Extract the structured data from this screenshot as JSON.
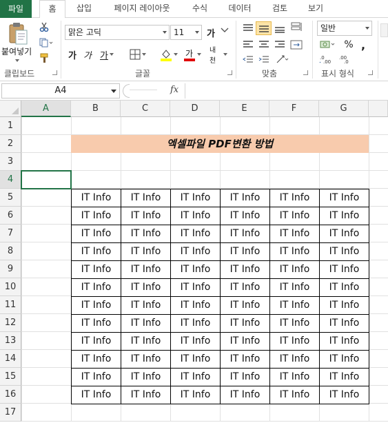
{
  "tabs": [
    "파일",
    "홈",
    "삽입",
    "페이지 레이아웃",
    "수식",
    "데이터",
    "검토",
    "보기"
  ],
  "active_tab": "홈",
  "clipboard": {
    "paste_label": "붙여넣기",
    "group_label": "클립보드"
  },
  "font": {
    "name": "맑은 고딕",
    "size": "11",
    "group_label": "글꼴",
    "grow_glyph": "가",
    "bold_glyph": "가",
    "italic_glyph": "가",
    "underline_glyph": "가",
    "phonetic_glyph": "내천"
  },
  "alignment": {
    "group_label": "맞춤"
  },
  "number": {
    "format": "일반",
    "percent": "%",
    "comma": ",",
    "group_label": "표시 형식"
  },
  "formula_bar": {
    "name_box": "A4",
    "fx_label": "fx",
    "formula": ""
  },
  "sheet": {
    "columns": [
      "A",
      "B",
      "C",
      "D",
      "E",
      "F",
      "G"
    ],
    "rows": [
      "1",
      "2",
      "3",
      "4",
      "5",
      "6",
      "7",
      "8",
      "9",
      "10",
      "11",
      "12",
      "13",
      "14",
      "15",
      "16",
      "17"
    ],
    "title": "엑셀파일 PDF변환 방법",
    "title_fill": "#f8cbad",
    "selected_cell": "A4",
    "table_cells": [
      [
        "IT Info",
        "IT Info",
        "IT Info",
        "IT Info",
        "IT Info",
        "IT Info"
      ],
      [
        "IT Info",
        "IT Info",
        "IT Info",
        "IT Info",
        "IT Info",
        "IT Info"
      ],
      [
        "IT Info",
        "IT Info",
        "IT Info",
        "IT Info",
        "IT Info",
        "IT Info"
      ],
      [
        "IT Info",
        "IT Info",
        "IT Info",
        "IT Info",
        "IT Info",
        "IT Info"
      ],
      [
        "IT Info",
        "IT Info",
        "IT Info",
        "IT Info",
        "IT Info",
        "IT Info"
      ],
      [
        "IT Info",
        "IT Info",
        "IT Info",
        "IT Info",
        "IT Info",
        "IT Info"
      ],
      [
        "IT Info",
        "IT Info",
        "IT Info",
        "IT Info",
        "IT Info",
        "IT Info"
      ],
      [
        "IT Info",
        "IT Info",
        "IT Info",
        "IT Info",
        "IT Info",
        "IT Info"
      ],
      [
        "IT Info",
        "IT Info",
        "IT Info",
        "IT Info",
        "IT Info",
        "IT Info"
      ],
      [
        "IT Info",
        "IT Info",
        "IT Info",
        "IT Info",
        "IT Info",
        "IT Info"
      ],
      [
        "IT Info",
        "IT Info",
        "IT Info",
        "IT Info",
        "IT Info",
        "IT Info"
      ],
      [
        "IT Info",
        "IT Info",
        "IT Info",
        "IT Info",
        "IT Info",
        "IT Info"
      ]
    ]
  },
  "colors": {
    "accent": "#217346",
    "header_bg": "#f3f3f3",
    "font_color_bar": "#e00000",
    "fill_color_bar": "#ffff00"
  }
}
